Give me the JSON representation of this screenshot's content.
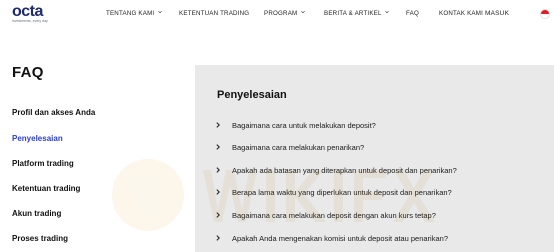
{
  "header": {
    "logo_text": "octa",
    "logo_tagline": "investments, every day",
    "nav": [
      {
        "label": "TENTANG KAMI",
        "dropdown": true
      },
      {
        "label": "KETENTUAN TRADING",
        "dropdown": false
      },
      {
        "label": "PROGRAM",
        "dropdown": true
      },
      {
        "label": "BERITA & ARTIKEL",
        "dropdown": true
      },
      {
        "label": "FAQ",
        "dropdown": false
      },
      {
        "label": "KONTAK KAMI",
        "dropdown": false
      }
    ],
    "login_label": "MASUK",
    "language_flag": "indonesia-flag-icon"
  },
  "page": {
    "title": "FAQ"
  },
  "sidebar": {
    "items": [
      {
        "label": "Profil dan akses Anda",
        "active": false
      },
      {
        "label": "Penyelesaian",
        "active": true
      },
      {
        "label": "Platform trading",
        "active": false
      },
      {
        "label": "Ketentuan trading",
        "active": false
      },
      {
        "label": "Akun trading",
        "active": false
      },
      {
        "label": "Proses trading",
        "active": false
      }
    ]
  },
  "section": {
    "title": "Penyelesaian",
    "questions": [
      "Bagaimana cara untuk melakukan deposit?",
      "Bagaimana cara melakukan penarikan?",
      "Apakah ada batasan yang diterapkan untuk deposit dan penarikan?",
      "Berapa lama waktu yang diperlukan untuk deposit dan penarikan?",
      "Bagaimana cara melakukan deposit dengan akun kurs tetap?",
      "Apakah Anda mengenakan komisi untuk deposit atau penarikan?"
    ]
  },
  "colors": {
    "brand": "#1f2a6b",
    "active_link": "#2b3fd6",
    "panel_bg": "#e9e9e9"
  }
}
